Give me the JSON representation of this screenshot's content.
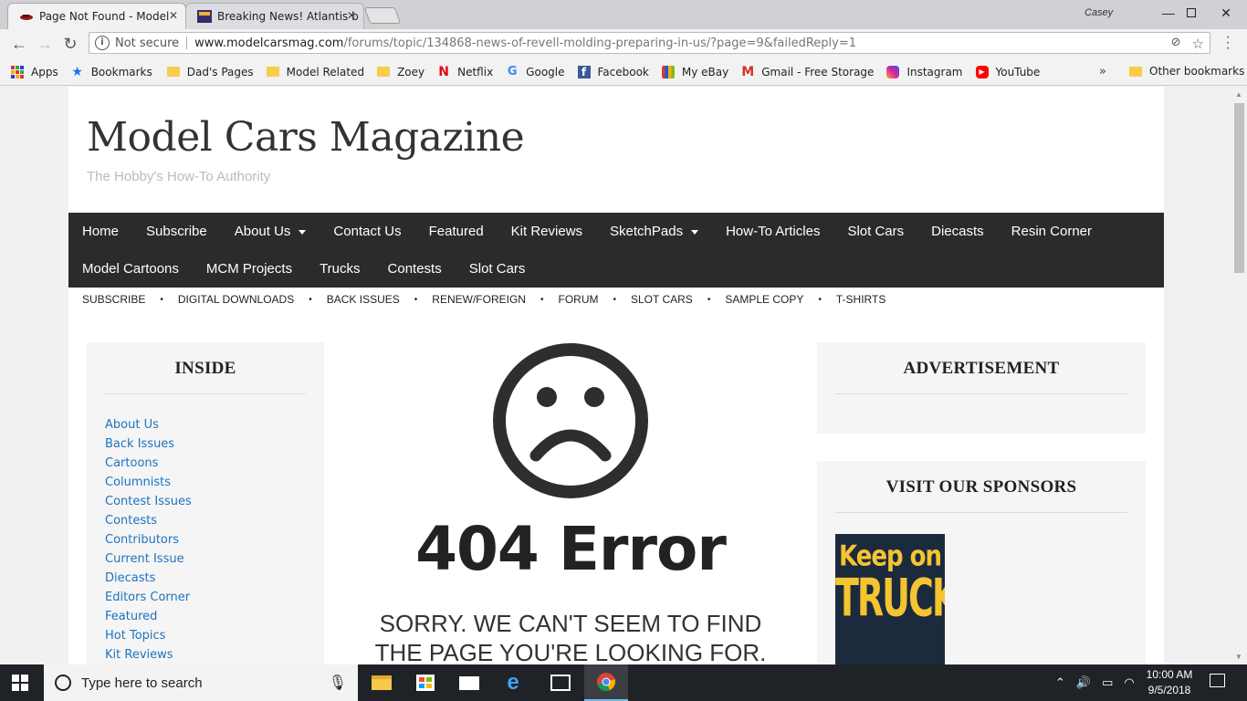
{
  "browser": {
    "tabs": [
      {
        "title": "Page Not Found - Model",
        "active": true
      },
      {
        "title": "Breaking News! Atlantis b",
        "active": false
      }
    ],
    "profile_name": "Casey",
    "url": {
      "security_label": "Not secure",
      "host": "www.modelcarsmag.com",
      "path": "/forums/topic/134868-news-of-revell-molding-preparing-in-us/?page=9&failedReply=1"
    },
    "bookmarks": [
      {
        "label": "Apps",
        "icon": "apps-grid-icon"
      },
      {
        "label": "Bookmarks",
        "icon": "star-icon"
      },
      {
        "label": "Dad's Pages",
        "icon": "folder-icon"
      },
      {
        "label": "Model Related",
        "icon": "folder-icon"
      },
      {
        "label": "Zoey",
        "icon": "folder-icon"
      },
      {
        "label": "Netflix",
        "icon": "netflix-icon"
      },
      {
        "label": "Google",
        "icon": "google-icon"
      },
      {
        "label": "Facebook",
        "icon": "facebook-icon"
      },
      {
        "label": "My eBay",
        "icon": "ebay-icon"
      },
      {
        "label": "Gmail - Free Storage",
        "icon": "gmail-icon"
      },
      {
        "label": "Instagram",
        "icon": "instagram-icon"
      },
      {
        "label": "YouTube",
        "icon": "youtube-icon"
      }
    ],
    "more_bookmarks": "»",
    "other_bookmarks": "Other bookmarks"
  },
  "site": {
    "title": "Model Cars Magazine",
    "tagline": "The Hobby's How-To Authority",
    "main_nav": [
      {
        "label": "Home",
        "dropdown": false
      },
      {
        "label": "Subscribe",
        "dropdown": false
      },
      {
        "label": "About Us",
        "dropdown": true
      },
      {
        "label": "Contact Us",
        "dropdown": false
      },
      {
        "label": "Featured",
        "dropdown": false
      },
      {
        "label": "Kit Reviews",
        "dropdown": false
      },
      {
        "label": "SketchPads",
        "dropdown": true
      },
      {
        "label": "How-To Articles",
        "dropdown": false
      },
      {
        "label": "Slot Cars",
        "dropdown": false
      },
      {
        "label": "Diecasts",
        "dropdown": false
      },
      {
        "label": "Resin Corner",
        "dropdown": false
      },
      {
        "label": "Model Cartoons",
        "dropdown": false
      },
      {
        "label": "MCM Projects",
        "dropdown": false
      },
      {
        "label": "Trucks",
        "dropdown": false
      },
      {
        "label": "Contests",
        "dropdown": false
      },
      {
        "label": "Slot Cars",
        "dropdown": false
      }
    ],
    "sub_nav": [
      "SUBSCRIBE",
      "DIGITAL DOWNLOADS",
      "BACK ISSUES",
      "RENEW/FOREIGN",
      "FORUM",
      "SLOT CARS",
      "SAMPLE COPY",
      "T-SHIRTS"
    ],
    "sidebar_left": {
      "title": "INSIDE",
      "links": [
        "About Us",
        "Back Issues",
        "Cartoons",
        "Columnists",
        "Contest Issues",
        "Contests",
        "Contributors",
        "Current Issue",
        "Diecasts",
        "Editors Corner",
        "Featured",
        "Hot Topics",
        "Kit Reviews"
      ]
    },
    "error": {
      "code": "404 Error",
      "message": "SORRY. WE CAN'T SEEM TO FIND THE PAGE YOU'RE LOOKING FOR."
    },
    "sidebar_right": {
      "ad_title": "ADVERTISEMENT",
      "sponsors_title": "VISIT OUR SPONSORS",
      "sponsor_line1": "Keep on",
      "sponsor_line2": "TRUCKIN'"
    }
  },
  "taskbar": {
    "search_placeholder": "Type here to search",
    "time": "10:00 AM",
    "date": "9/5/2018"
  },
  "colors": {
    "nav_bg": "#2b2b2b",
    "link_blue": "#1e73be",
    "sponsor_yellow": "#f4c431"
  }
}
